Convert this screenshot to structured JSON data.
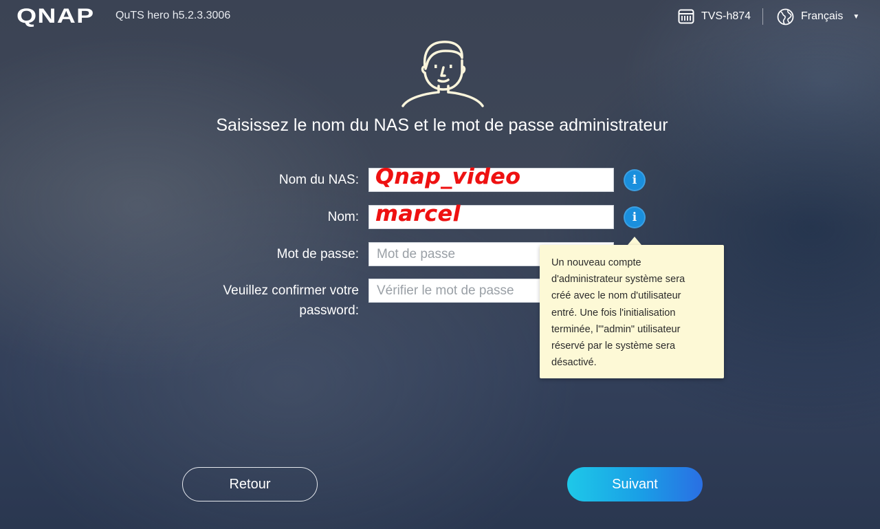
{
  "header": {
    "logo": "QNAP",
    "version": "QuTS hero h5.2.3.3006",
    "device_name": "TVS-h874",
    "language": "Français"
  },
  "title": "Saisissez le nom du NAS et le mot de passe administrateur",
  "form": {
    "nas_name_label": "Nom du NAS:",
    "nas_name_value": "Qnap_video",
    "name_label": "Nom:",
    "name_value": "marcel",
    "password_label": "Mot de passe:",
    "password_placeholder": "Mot de passe",
    "confirm_label_line1": "Veuillez confirmer votre",
    "confirm_label_line2": "password:",
    "confirm_placeholder": "Vérifier le mot de passe"
  },
  "tooltip": {
    "lines": [
      "Un nouveau compte",
      "d'administrateur système sera",
      "créé avec le nom d'utilisateur",
      "entré. Une fois l'initialisation",
      "terminée, l'\"admin\" utilisateur",
      "réservé par le système sera",
      "désactivé."
    ]
  },
  "buttons": {
    "back": "Retour",
    "next": "Suivant"
  },
  "icons": {
    "device": "nas-device-icon",
    "language": "globe-icon",
    "info": "info-icon",
    "avatar": "admin-avatar-icon"
  },
  "colors": {
    "accent": "#1a8fdd",
    "annotation": "#ee1111",
    "tooltip_bg": "#fdf9d6"
  }
}
